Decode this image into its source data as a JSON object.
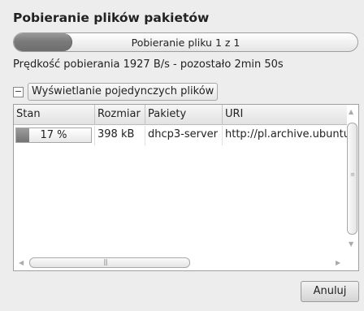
{
  "dialog": {
    "title": "Pobieranie plików pakietów"
  },
  "overall_progress": {
    "fraction": 0.17,
    "label": "Pobieranie pliku 1 z 1"
  },
  "status": {
    "speed_text": "Prędkość pobierania 1927  B/s - pozostało 2min 50s"
  },
  "expander": {
    "toggle_symbol": "−",
    "label": "Wyświetlanie pojedynczych plików"
  },
  "table": {
    "columns": [
      "Stan",
      "Rozmiar",
      "Pakiety",
      "URI"
    ],
    "rows": [
      {
        "progress_fraction": 0.17,
        "status": "17 %",
        "size": "398 kB",
        "package": "dhcp3-server",
        "uri": "http://pl.archive.ubuntu"
      }
    ]
  },
  "scrollbars": {
    "up_arrow": "▲",
    "down_arrow": "▼",
    "left_arrow": "◀",
    "right_arrow": "▶"
  },
  "buttons": {
    "cancel_label": "Anuluj"
  }
}
